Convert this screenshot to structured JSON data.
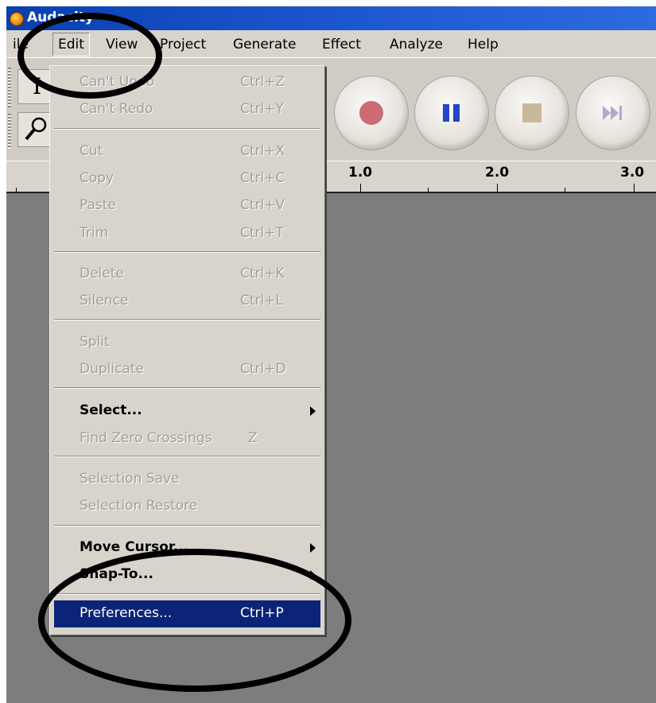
{
  "window": {
    "title": "Audacity",
    "icon": "audacity-logo-icon"
  },
  "menubar": {
    "items": [
      {
        "label": "ile"
      },
      {
        "label": "Edit"
      },
      {
        "label": "View"
      },
      {
        "label": "Project"
      },
      {
        "label": "Generate"
      },
      {
        "label": "Effect"
      },
      {
        "label": "Analyze"
      },
      {
        "label": "Help"
      }
    ],
    "open_menu": "Edit"
  },
  "toolbar": {
    "tools": [
      {
        "icon": "selection-tool-icon"
      },
      {
        "icon": "zoom-tool-icon"
      }
    ],
    "transport": [
      {
        "icon": "record-icon",
        "color": "#cc6b73"
      },
      {
        "icon": "pause-icon",
        "color": "#2446c8"
      },
      {
        "icon": "stop-icon",
        "color": "#c9b79a"
      },
      {
        "icon": "skip-to-end-icon",
        "color": "#b6a6cf"
      }
    ]
  },
  "ruler": {
    "labels": [
      "1.0",
      "2.0",
      "3.0"
    ]
  },
  "edit_menu": {
    "items": [
      {
        "label": "Can't Undo",
        "shortcut": "Ctrl+Z",
        "state": "disabled"
      },
      {
        "label": "Can't Redo",
        "shortcut": "Ctrl+Y",
        "state": "disabled"
      },
      {
        "label": "Cut",
        "shortcut": "Ctrl+X",
        "state": "disabled"
      },
      {
        "label": "Copy",
        "shortcut": "Ctrl+C",
        "state": "disabled"
      },
      {
        "label": "Paste",
        "shortcut": "Ctrl+V",
        "state": "disabled"
      },
      {
        "label": "Trim",
        "shortcut": "Ctrl+T",
        "state": "disabled"
      },
      {
        "label": "Delete",
        "shortcut": "Ctrl+K",
        "state": "disabled"
      },
      {
        "label": "Silence",
        "shortcut": "Ctrl+L",
        "state": "disabled"
      },
      {
        "label": "Split",
        "shortcut": "",
        "state": "disabled"
      },
      {
        "label": "Duplicate",
        "shortcut": "Ctrl+D",
        "state": "disabled"
      },
      {
        "label": "Select...",
        "shortcut": "",
        "state": "enabled",
        "submenu": true
      },
      {
        "label": "Find Zero Crossings",
        "shortcut": "Z",
        "state": "disabled"
      },
      {
        "label": "Selection Save",
        "shortcut": "",
        "state": "disabled"
      },
      {
        "label": "Selection Restore",
        "shortcut": "",
        "state": "disabled"
      },
      {
        "label": "Move Cursor...",
        "shortcut": "",
        "state": "enabled",
        "submenu": true
      },
      {
        "label": "Snap-To...",
        "shortcut": "",
        "state": "enabled",
        "submenu": true
      },
      {
        "label": "Preferences...",
        "shortcut": "Ctrl+P",
        "state": "highlighted"
      }
    ]
  },
  "colors": {
    "menu_highlight": "#0b2479",
    "workspace": "#7d7d7d",
    "title_bar": "#1c56cf"
  }
}
